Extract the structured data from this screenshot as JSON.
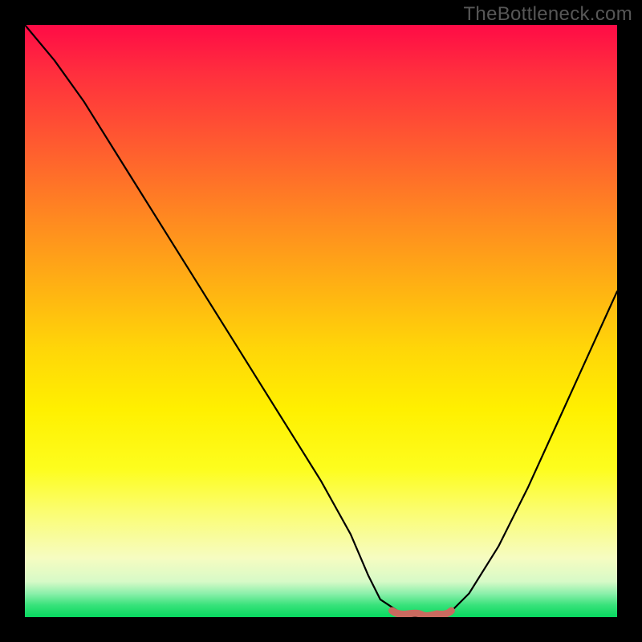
{
  "watermark": "TheBottleneck.com",
  "colors": {
    "gradient_top": "#ff0b46",
    "gradient_bottom": "#07d85f",
    "curve": "#000000",
    "marker": "#c96a5f",
    "frame": "#000000"
  },
  "chart_data": {
    "type": "line",
    "title": "",
    "xlabel": "",
    "ylabel": "",
    "xlim": [
      0,
      100
    ],
    "ylim": [
      0,
      100
    ],
    "x": [
      0,
      5,
      10,
      15,
      20,
      25,
      30,
      35,
      40,
      45,
      50,
      55,
      58,
      60,
      63,
      66,
      69,
      72,
      75,
      80,
      85,
      90,
      95,
      100
    ],
    "values": [
      100,
      94,
      87,
      79,
      71,
      63,
      55,
      47,
      39,
      31,
      23,
      14,
      7,
      3,
      1,
      0,
      0,
      1,
      4,
      12,
      22,
      33,
      44,
      55
    ],
    "minimum_region": {
      "x_start": 62,
      "x_end": 72,
      "y": 0
    },
    "annotations": []
  }
}
